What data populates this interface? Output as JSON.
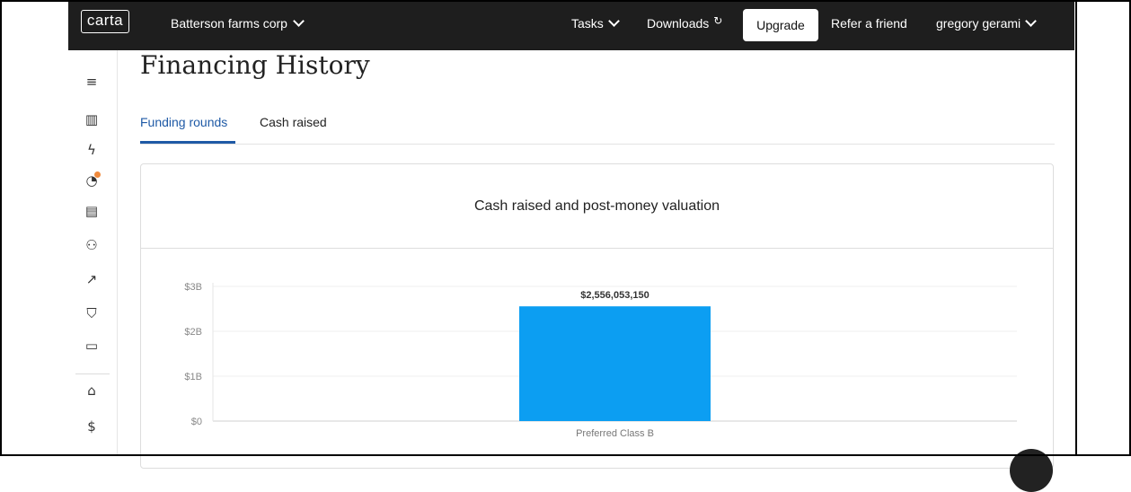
{
  "nav": {
    "logo": "carta",
    "company": "Batterson farms corp",
    "tasks": "Tasks",
    "downloads": "Downloads",
    "upgrade": "Upgrade",
    "refer": "Refer a friend",
    "user": "gregory gerami"
  },
  "sidebar": {
    "items": [
      {
        "name": "menu-icon",
        "glyph": "≡"
      },
      {
        "name": "dashboard-chart-icon",
        "glyph": "▥"
      },
      {
        "name": "bolt-icon",
        "glyph": "ϟ"
      },
      {
        "name": "pie-chart-icon",
        "glyph": "◔"
      },
      {
        "name": "document-icon",
        "glyph": "▤"
      },
      {
        "name": "people-icon",
        "glyph": "⚇"
      },
      {
        "name": "line-chart-icon",
        "glyph": "↗"
      },
      {
        "name": "shield-icon",
        "glyph": "⛉"
      },
      {
        "name": "folder-icon",
        "glyph": "▭"
      },
      {
        "name": "bank-icon",
        "glyph": "⌂"
      },
      {
        "name": "dollar-icon",
        "glyph": "$"
      }
    ],
    "notification_color": "#f08a3c"
  },
  "page": {
    "title": "Financing History",
    "tabs": [
      {
        "label": "Funding rounds",
        "active": true
      },
      {
        "label": "Cash raised",
        "active": false
      }
    ]
  },
  "chart_data": {
    "type": "bar",
    "title": "Cash raised and post-money valuation",
    "categories": [
      "Preferred Class B"
    ],
    "values": [
      2556053150
    ],
    "data_labels": [
      "$2,556,053,150"
    ],
    "yticks": [
      "$0",
      "$1B",
      "$2B",
      "$3B"
    ],
    "ylim": [
      0,
      3000000000
    ],
    "grid": true,
    "bar_color": "#0c9ef2"
  }
}
